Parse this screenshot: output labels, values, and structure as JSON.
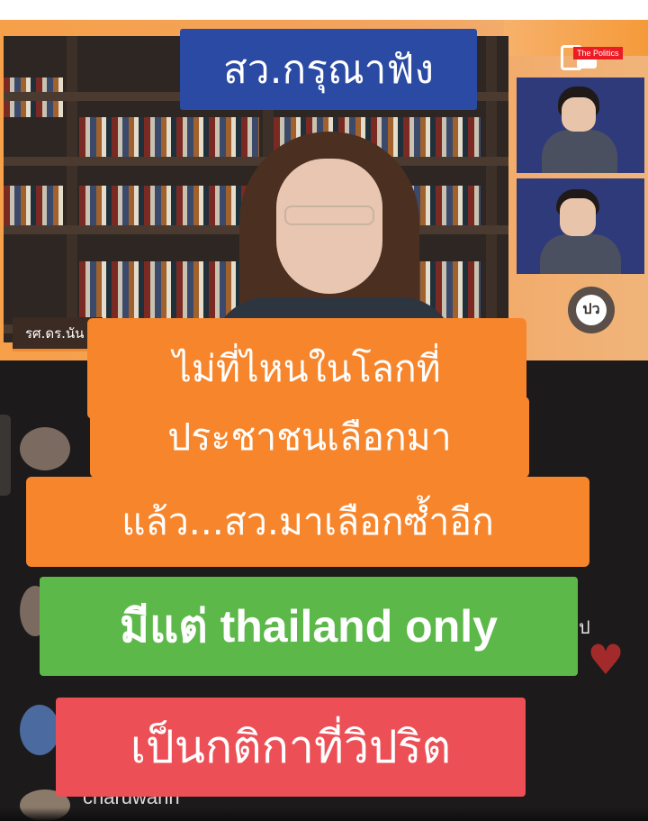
{
  "broadcast": {
    "logo_tag": "The Politics",
    "logo_badge": "ปว",
    "presenter_name_partial": "รศ.ดร.นัน"
  },
  "captions": {
    "top": "สว.กรุณาฟัง",
    "line1": "ไม่ที่ไหนในโลกที่",
    "line2": "ประชาชนเลือกมา",
    "line3": "แล้ว...สว.มาเลือกซ้ำอีก",
    "highlight": "มีแต่ thailand only",
    "conclusion": "เป็นกติกาที่วิปริต"
  },
  "comments": {
    "partial_char": "ป",
    "username_partial": "charuwann",
    "reaction_icon": "heart-icon"
  },
  "colors": {
    "caption_blue": "#2b4aa4",
    "caption_orange": "#f7852c",
    "caption_green": "#5db84a",
    "caption_red": "#ec4f55",
    "brand_orange": "#f59a3a"
  }
}
